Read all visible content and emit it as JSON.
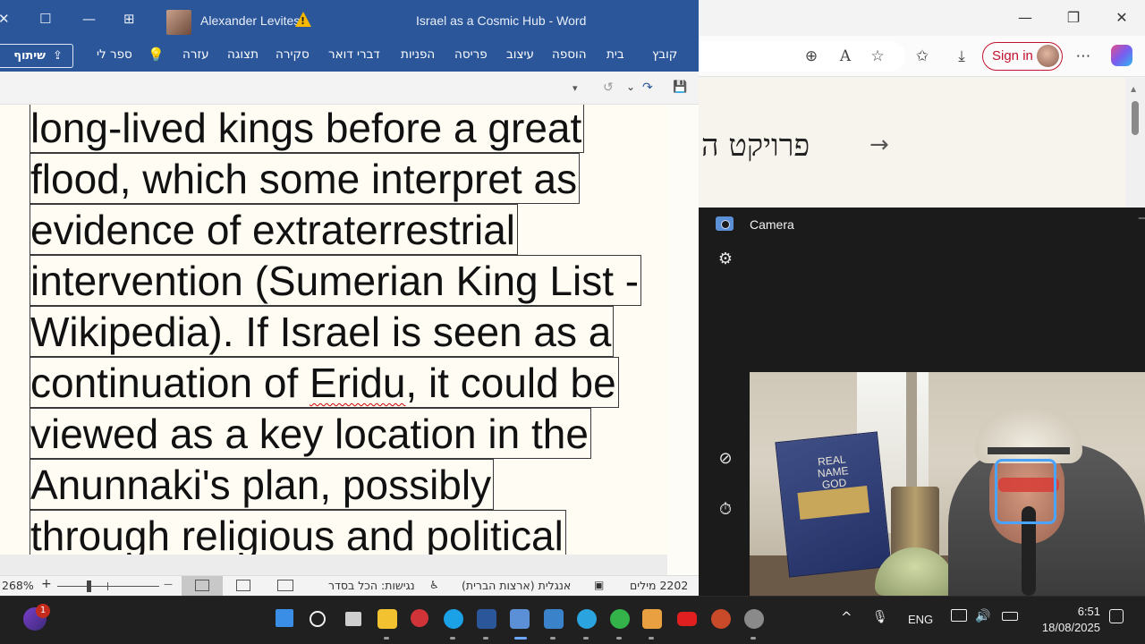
{
  "browser": {
    "signin_label": "Sign in",
    "page_heading": "פרויקט ה",
    "arrow": "→",
    "buttons": {
      "minimize": "—",
      "restore": "❐",
      "close": "✕"
    },
    "toolbar_icons": {
      "zoom": "⊕",
      "read_aloud": "A",
      "favorite": "☆",
      "favorites": "✩",
      "downloads": "⤓",
      "more": "⋯"
    }
  },
  "word": {
    "title_user": "Alexander Levites",
    "doc_title": "Israel as a Cosmic Hub  -  Word",
    "warning_mark": "!",
    "title_buttons": {
      "close": "✕",
      "restore": "☐",
      "minimize": "—",
      "ribbon_display": "⊞"
    },
    "share_label": "שיתוף",
    "share_icon": "⇪",
    "ribbon_tabs": [
      "קובץ",
      "בית",
      "הוספה",
      "עיצוב",
      "פריסה",
      "הפניות",
      "דברי דואר",
      "סקירה",
      "תצוגה",
      "עזרה"
    ],
    "tell_me": "ספר לי",
    "qat": {
      "save": "💾",
      "redo": "↷",
      "undo_more": "⌄",
      "undo": "↺",
      "customize": "▾"
    },
    "document_lines": [
      {
        "text": "long-lived kings before a great"
      },
      {
        "text": "flood, which some interpret as"
      },
      {
        "text": "evidence of extraterrestrial"
      },
      {
        "text": "intervention (Sumerian King List -"
      },
      {
        "text": "Wikipedia). If Israel is seen as a"
      },
      {
        "pre": "continuation of ",
        "err": "Eridu",
        "post": ", it could be"
      },
      {
        "text": "viewed as a key location in the"
      },
      {
        "text": "Anunnaki's plan, possibly"
      },
      {
        "text": "through religious and political"
      }
    ],
    "status": {
      "word_count": "2202 מילים",
      "language": "אנגלית (ארצות הברית)",
      "accessibility": "נגישות: הכל בסדר",
      "zoom_level": "268%",
      "zoom_minus": "—",
      "zoom_plus": "+",
      "zoom_fraction": 0.31
    }
  },
  "camera": {
    "title": "Camera",
    "feed_book_text": "REAL NAME GOD",
    "buttons": {
      "settings": "⚙",
      "hdr_off": "⊘",
      "timer": "⏱"
    }
  },
  "taskbar": {
    "notification_count": "1",
    "lang": "ENG",
    "time": "6:51",
    "date": "18/08/2025",
    "tray": {
      "chevron": "^",
      "mic": "🎙",
      "volume": "🔊"
    },
    "colors": {
      "start": "#3a8ee6",
      "search": "#ffffff",
      "task_view": "#cfcfcf",
      "explorer": "#f2c230",
      "recorder": "#d13438",
      "edge": "#1aa1e6",
      "word": "#2b579a",
      "camera": "#5b8fd6",
      "paint": "#3a82c9",
      "telegram": "#2aa3df",
      "media_player": "#34b34a",
      "clipchamp": "#e8a040",
      "youtube": "#e02020",
      "powerpoint": "#c84a28",
      "settings": "#8a8a8a"
    }
  }
}
